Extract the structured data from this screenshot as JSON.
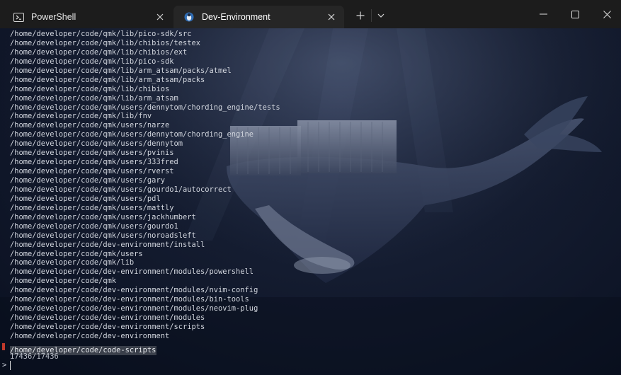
{
  "tabs": [
    {
      "title": "PowerShell",
      "icon": "powershell-icon",
      "active": false
    },
    {
      "title": "Dev-Environment",
      "icon": "ubuntu-penguin-icon",
      "active": true
    }
  ],
  "terminal": {
    "lines": [
      "/home/developer/code/qmk/lib/pico-sdk/src",
      "/home/developer/code/qmk/lib/chibios/testex",
      "/home/developer/code/qmk/lib/chibios/ext",
      "/home/developer/code/qmk/lib/pico-sdk",
      "/home/developer/code/qmk/lib/arm_atsam/packs/atmel",
      "/home/developer/code/qmk/lib/arm_atsam/packs",
      "/home/developer/code/qmk/lib/chibios",
      "/home/developer/code/qmk/lib/arm_atsam",
      "/home/developer/code/qmk/users/dennytom/chording_engine/tests",
      "/home/developer/code/qmk/lib/fnv",
      "/home/developer/code/qmk/users/narze",
      "/home/developer/code/qmk/users/dennytom/chording_engine",
      "/home/developer/code/qmk/users/dennytom",
      "/home/developer/code/qmk/users/pvinis",
      "/home/developer/code/qmk/users/333fred",
      "/home/developer/code/qmk/users/rverst",
      "/home/developer/code/qmk/users/gary",
      "/home/developer/code/qmk/users/gourdo1/autocorrect",
      "/home/developer/code/qmk/users/pdl",
      "/home/developer/code/qmk/users/mattly",
      "/home/developer/code/qmk/users/jackhumbert",
      "/home/developer/code/qmk/users/gourdo1",
      "/home/developer/code/qmk/users/noroadsleft",
      "/home/developer/code/dev-environment/install",
      "/home/developer/code/qmk/users",
      "/home/developer/code/qmk/lib",
      "/home/developer/code/dev-environment/modules/powershell",
      "/home/developer/code/qmk",
      "/home/developer/code/dev-environment/modules/nvim-config",
      "/home/developer/code/dev-environment/modules/bin-tools",
      "/home/developer/code/dev-environment/modules/neovim-plug",
      "/home/developer/code/dev-environment/modules",
      "/home/developer/code/dev-environment/scripts",
      "/home/developer/code/dev-environment"
    ],
    "selected_line": "/home/developer/code/code-scripts",
    "match_count": "17436/17436",
    "prompt_symbol": ">"
  },
  "colors": {
    "titlebar": "#1c1c1c",
    "active_tab": "#262626",
    "terminal_text": "#d2d6de",
    "selection_marker": "#c0392b"
  }
}
